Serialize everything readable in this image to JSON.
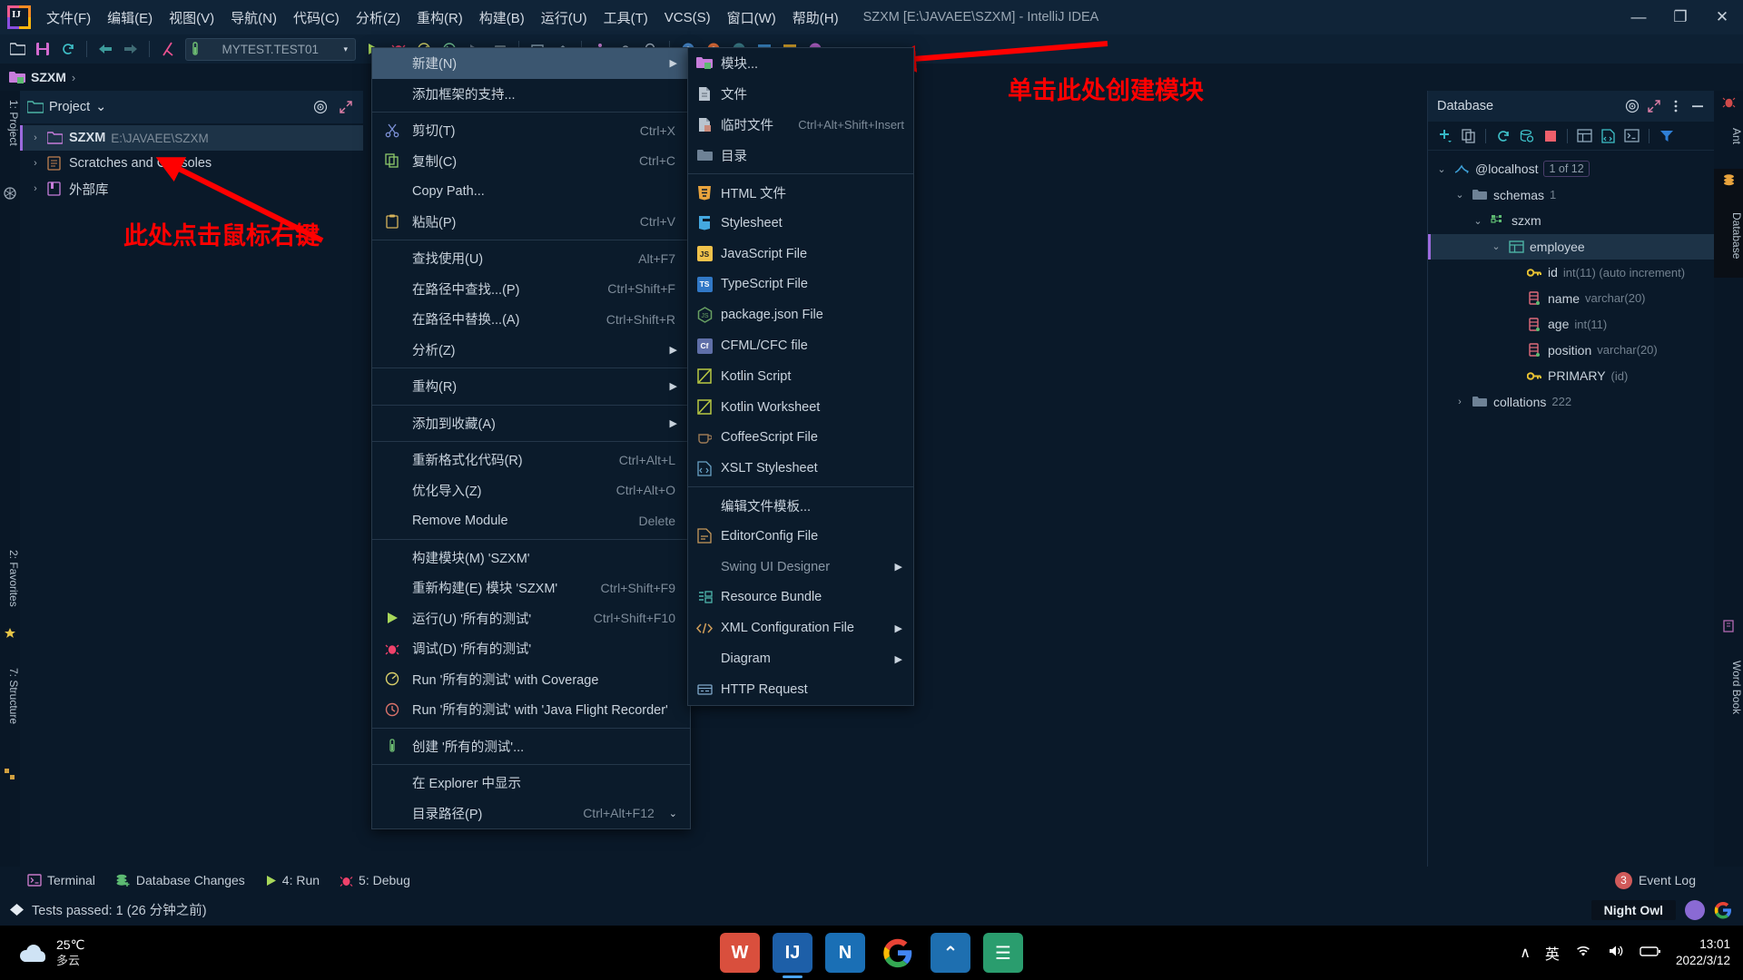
{
  "window": {
    "title": "SZXM [E:\\JAVAEE\\SZXM] - IntelliJ IDEA",
    "minimize": "—",
    "maximize": "❐",
    "close": "✕"
  },
  "menubar": [
    {
      "label": "文件(F)"
    },
    {
      "label": "编辑(E)"
    },
    {
      "label": "视图(V)"
    },
    {
      "label": "导航(N)"
    },
    {
      "label": "代码(C)"
    },
    {
      "label": "分析(Z)"
    },
    {
      "label": "重构(R)"
    },
    {
      "label": "构建(B)"
    },
    {
      "label": "运行(U)"
    },
    {
      "label": "工具(T)"
    },
    {
      "label": "VCS(S)"
    },
    {
      "label": "窗口(W)"
    },
    {
      "label": "帮助(H)"
    }
  ],
  "toolbar": {
    "run_config": "MYTEST.TEST01",
    "run_config_arrow": "▾"
  },
  "navbar": {
    "project_crumb": "SZXM",
    "chevron": "›"
  },
  "left_stripe": {
    "project_tab": "1: Project",
    "favorites_tab": "2: Favorites",
    "structure_tab": "7: Structure"
  },
  "project_panel": {
    "title": "Project",
    "title_arrow": "⌄",
    "tree": [
      {
        "label": "SZXM",
        "sub": "E:\\JAVAEE\\SZXM",
        "twisty": "›",
        "selected": true,
        "bold": true
      },
      {
        "label": "Scratches and Consoles",
        "sub": "",
        "twisty": "›",
        "selected": false,
        "bold": false
      },
      {
        "label": "外部库",
        "sub": "",
        "twisty": "›",
        "selected": false,
        "bold": false
      }
    ]
  },
  "annotations": [
    {
      "text": "此处点击鼠标右键",
      "color": "#ff0000"
    },
    {
      "text": "单击此处创建模块",
      "color": "#ff0000"
    }
  ],
  "context_menu": [
    {
      "label": "新建(N)",
      "key": "",
      "arrow": "▶",
      "icon": "",
      "highlight": true
    },
    {
      "label": "添加框架的支持...",
      "key": "",
      "arrow": "",
      "icon": "",
      "highlight": false
    },
    {
      "sep": true
    },
    {
      "label": "剪切(T)",
      "key": "Ctrl+X",
      "arrow": "",
      "icon": "scissors-icon",
      "highlight": false
    },
    {
      "label": "复制(C)",
      "key": "Ctrl+C",
      "arrow": "",
      "icon": "copy-icon",
      "highlight": false
    },
    {
      "label": "Copy Path...",
      "key": "",
      "arrow": "",
      "icon": "",
      "highlight": false
    },
    {
      "label": "粘贴(P)",
      "key": "Ctrl+V",
      "arrow": "",
      "icon": "clipboard-icon",
      "highlight": false
    },
    {
      "sep": true
    },
    {
      "label": "查找使用(U)",
      "key": "Alt+F7",
      "arrow": "",
      "icon": "",
      "highlight": false
    },
    {
      "label": "在路径中查找...(P)",
      "key": "Ctrl+Shift+F",
      "arrow": "",
      "icon": "",
      "highlight": false
    },
    {
      "label": "在路径中替换...(A)",
      "key": "Ctrl+Shift+R",
      "arrow": "",
      "icon": "",
      "highlight": false
    },
    {
      "label": "分析(Z)",
      "key": "",
      "arrow": "▶",
      "icon": "",
      "highlight": false
    },
    {
      "sep": true
    },
    {
      "label": "重构(R)",
      "key": "",
      "arrow": "▶",
      "icon": "",
      "highlight": false
    },
    {
      "sep": true
    },
    {
      "label": "添加到收藏(A)",
      "key": "",
      "arrow": "▶",
      "icon": "",
      "highlight": false
    },
    {
      "sep": true
    },
    {
      "label": "重新格式化代码(R)",
      "key": "Ctrl+Alt+L",
      "arrow": "",
      "icon": "",
      "highlight": false
    },
    {
      "label": "优化导入(Z)",
      "key": "Ctrl+Alt+O",
      "arrow": "",
      "icon": "",
      "highlight": false
    },
    {
      "label": "Remove Module",
      "key": "Delete",
      "arrow": "",
      "icon": "",
      "highlight": false
    },
    {
      "sep": true
    },
    {
      "label": "构建模块(M) 'SZXM'",
      "key": "",
      "arrow": "",
      "icon": "",
      "highlight": false
    },
    {
      "label": "重新构建(E) 模块 'SZXM'",
      "key": "Ctrl+Shift+F9",
      "arrow": "",
      "icon": "",
      "highlight": false
    },
    {
      "label": "运行(U) '所有的测试'",
      "key": "Ctrl+Shift+F10",
      "arrow": "",
      "icon": "run-icon",
      "highlight": false
    },
    {
      "label": "调试(D) '所有的测试'",
      "key": "",
      "arrow": "",
      "icon": "debug-icon",
      "highlight": false
    },
    {
      "label": "Run '所有的测试' with Coverage",
      "key": "",
      "arrow": "",
      "icon": "coverage-icon",
      "highlight": false
    },
    {
      "label": "Run '所有的测试' with 'Java Flight Recorder'",
      "key": "",
      "arrow": "",
      "icon": "jfr-icon",
      "highlight": false
    },
    {
      "sep": true
    },
    {
      "label": "创建 '所有的测试'...",
      "key": "",
      "arrow": "",
      "icon": "test-icon",
      "highlight": false
    },
    {
      "sep": true
    },
    {
      "label": "在 Explorer 中显示",
      "key": "",
      "arrow": "",
      "icon": "",
      "highlight": false
    },
    {
      "label": "目录路径(P)",
      "key": "Ctrl+Alt+F12",
      "arrow": "⌄",
      "icon": "",
      "highlight": false
    }
  ],
  "submenu": [
    {
      "label": "模块...",
      "key": "",
      "arrow": "",
      "icon": "module-icon",
      "color": "#c77ddb"
    },
    {
      "label": "文件",
      "key": "",
      "arrow": "",
      "icon": "file-icon",
      "color": "#b9c4cf"
    },
    {
      "label": "临时文件",
      "key": "Ctrl+Alt+Shift+Insert",
      "arrow": "",
      "icon": "scratch-file-icon",
      "color": "#b9c4cf"
    },
    {
      "label": "目录",
      "key": "",
      "arrow": "",
      "icon": "directory-icon",
      "color": "#6e8296"
    },
    {
      "sep": true
    },
    {
      "label": "HTML 文件",
      "key": "",
      "arrow": "",
      "icon": "html5-icon",
      "color": "#e8a33d"
    },
    {
      "label": "Stylesheet",
      "key": "",
      "arrow": "",
      "icon": "css3-icon",
      "color": "#44a8e0"
    },
    {
      "label": "JavaScript File",
      "key": "",
      "arrow": "",
      "icon": "javascript-icon",
      "color": "#f0c24b"
    },
    {
      "label": "TypeScript File",
      "key": "",
      "arrow": "",
      "icon": "typescript-icon",
      "color": "#3178c6"
    },
    {
      "label": "package.json File",
      "key": "",
      "arrow": "",
      "icon": "nodejs-icon",
      "color": "#68a063"
    },
    {
      "label": "CFML/CFC file",
      "key": "",
      "arrow": "",
      "icon": "coldfusion-icon",
      "color": "#5f6fa8"
    },
    {
      "label": "Kotlin Script",
      "key": "",
      "arrow": "",
      "icon": "kotlin-icon",
      "color": "#b9c943"
    },
    {
      "label": "Kotlin Worksheet",
      "key": "",
      "arrow": "",
      "icon": "kotlin-icon",
      "color": "#b9c943"
    },
    {
      "label": "CoffeeScript File",
      "key": "",
      "arrow": "",
      "icon": "coffeescript-icon",
      "color": "#9c7a56"
    },
    {
      "label": "XSLT Stylesheet",
      "key": "",
      "arrow": "",
      "icon": "xslt-icon",
      "color": "#6aa3c7"
    },
    {
      "sep": true
    },
    {
      "label": "编辑文件模板...",
      "key": "",
      "arrow": "",
      "icon": "",
      "color": ""
    },
    {
      "label": "EditorConfig File",
      "key": "",
      "arrow": "",
      "icon": "editorconfig-icon",
      "color": "#c89a5a"
    },
    {
      "label": "Swing UI Designer",
      "key": "",
      "arrow": "▶",
      "icon": "",
      "color": "",
      "dim": true
    },
    {
      "label": "Resource Bundle",
      "key": "",
      "arrow": "",
      "icon": "resource-bundle-icon",
      "color": "#4db6ac"
    },
    {
      "label": "XML Configuration File",
      "key": "",
      "arrow": "▶",
      "icon": "xml-icon",
      "color": "#cf9d5a"
    },
    {
      "label": "Diagram",
      "key": "",
      "arrow": "▶",
      "icon": "",
      "color": ""
    },
    {
      "label": "HTTP Request",
      "key": "",
      "arrow": "",
      "icon": "http-request-icon",
      "color": "#7fa8c9"
    }
  ],
  "database_panel": {
    "title": "Database",
    "tree": [
      {
        "indent": 0,
        "twisty": "⌄",
        "icon": "mysql-icon",
        "name": "@localhost",
        "type": "",
        "badge": "1 of 12",
        "selected": false
      },
      {
        "indent": 1,
        "twisty": "⌄",
        "icon": "folder-icon",
        "name": "schemas",
        "type": "1",
        "badge": "",
        "selected": false
      },
      {
        "indent": 2,
        "twisty": "⌄",
        "icon": "schema-icon",
        "name": "szxm",
        "type": "",
        "badge": "",
        "selected": false
      },
      {
        "indent": 3,
        "twisty": "⌄",
        "icon": "table-icon",
        "name": "employee",
        "type": "",
        "badge": "",
        "selected": true
      },
      {
        "indent": 4,
        "twisty": "",
        "icon": "key-icon",
        "name": "id",
        "type": "int(11) (auto increment)",
        "badge": "",
        "selected": false
      },
      {
        "indent": 4,
        "twisty": "",
        "icon": "column-icon",
        "name": "name",
        "type": "varchar(20)",
        "badge": "",
        "selected": false
      },
      {
        "indent": 4,
        "twisty": "",
        "icon": "column-icon",
        "name": "age",
        "type": "int(11)",
        "badge": "",
        "selected": false
      },
      {
        "indent": 4,
        "twisty": "",
        "icon": "column-icon",
        "name": "position",
        "type": "varchar(20)",
        "badge": "",
        "selected": false
      },
      {
        "indent": 4,
        "twisty": "",
        "icon": "key-icon",
        "name": "PRIMARY",
        "type": "(id)",
        "badge": "",
        "selected": false
      },
      {
        "indent": 1,
        "twisty": "›",
        "icon": "folder-icon",
        "name": "collations",
        "type": "222",
        "badge": "",
        "selected": false
      }
    ]
  },
  "right_stripe": {
    "ant_tab": "Ant",
    "database_tab": "Database",
    "word_book_tab": "Word Book"
  },
  "bottom_bar": [
    {
      "label": "Terminal",
      "icon": "terminal-icon"
    },
    {
      "label": "Database Changes",
      "icon": "database-changes-icon"
    },
    {
      "label": "4: Run",
      "icon": "run-icon"
    },
    {
      "label": "5: Debug",
      "icon": "debug-icon"
    }
  ],
  "status_bar": {
    "message": "Tests passed: 1 (26 分钟之前)",
    "event_log": "Event Log",
    "event_log_count": "3",
    "night_owl": "Night Owl"
  },
  "taskbar": {
    "weather_temp": "25℃",
    "weather_desc": "多云",
    "time": "13:01",
    "date": "2022/3/12",
    "ime": "英",
    "chevron": "∧",
    "apps": [
      {
        "name": "wps-icon",
        "glyph": "W",
        "bg": "#d94f3d",
        "active": false
      },
      {
        "name": "intellij-idea-icon",
        "glyph": "IJ",
        "bg": "#1d5fa8",
        "active": true
      },
      {
        "name": "navicat-icon",
        "glyph": "N",
        "bg": "#1a6fb5",
        "active": false
      },
      {
        "name": "chrome-icon",
        "glyph": "",
        "bg": "#ffffff",
        "active": false
      },
      {
        "name": "xmind-icon",
        "glyph": "⌃",
        "bg": "#1e6fb0",
        "active": false
      },
      {
        "name": "notes-icon",
        "glyph": "☰",
        "bg": "#2a9d6e",
        "active": false
      }
    ]
  }
}
